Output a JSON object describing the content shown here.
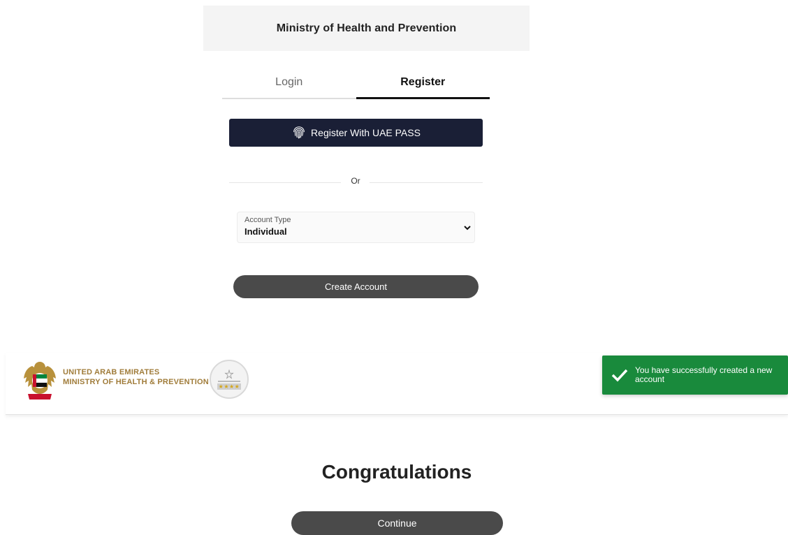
{
  "header": {
    "title": "Ministry of Health and Prevention"
  },
  "tabs": [
    {
      "label": "Login",
      "active": false
    },
    {
      "label": "Register",
      "active": true
    }
  ],
  "uaepass": {
    "label": "Register With UAE PASS",
    "icon": "fingerprint-icon"
  },
  "divider": {
    "text": "Or"
  },
  "account_type": {
    "label": "Account Type",
    "value": "Individual"
  },
  "create_account": {
    "label": "Create Account"
  },
  "footer": {
    "line1": "UNITED ARAB EMIRATES",
    "line2": "MINISTRY OF HEALTH & PREVENTION",
    "brand_color": "#a07c3a"
  },
  "toast": {
    "message": "You have successfully created a new account",
    "color": "#198a3c",
    "icon": "check-icon"
  },
  "congrats": {
    "title": "Congratulations",
    "continue_label": "Continue"
  }
}
